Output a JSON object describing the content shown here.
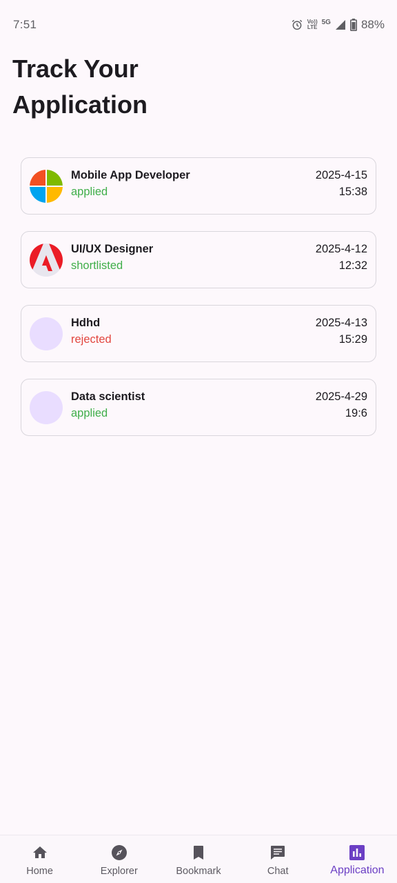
{
  "status_bar": {
    "time": "7:51",
    "volte_top": "Vo))",
    "volte_bottom": "LTE",
    "network": "5G",
    "battery": "88%"
  },
  "page": {
    "title_line1": "Track Your",
    "title_line2": "Application"
  },
  "applications": [
    {
      "title": "Mobile App Developer",
      "status": "applied",
      "date": "2025-4-15",
      "time": "15:38",
      "logo": "microsoft-logo-icon"
    },
    {
      "title": "UI/UX Designer",
      "status": "shortlisted",
      "date": "2025-4-12",
      "time": "12:32",
      "logo": "adobe-logo-icon"
    },
    {
      "title": "Hdhd",
      "status": "rejected",
      "date": "2025-4-13",
      "time": "15:29",
      "logo": "placeholder-avatar-icon"
    },
    {
      "title": "Data scientist",
      "status": "applied",
      "date": "2025-4-29",
      "time": "19:6",
      "logo": "placeholder-avatar-icon"
    }
  ],
  "colors": {
    "accent": "#6b3fc4",
    "status_applied": "#3fae49",
    "status_rejected": "#e2463f",
    "logo_placeholder": "#e9ddff"
  },
  "bottom_nav": {
    "items": [
      {
        "label": "Home",
        "icon": "home-icon"
      },
      {
        "label": "Explorer",
        "icon": "compass-icon"
      },
      {
        "label": "Bookmark",
        "icon": "bookmark-icon"
      },
      {
        "label": "Chat",
        "icon": "chat-icon"
      },
      {
        "label": "Application",
        "icon": "bar-chart-icon"
      }
    ],
    "active": "Application"
  }
}
